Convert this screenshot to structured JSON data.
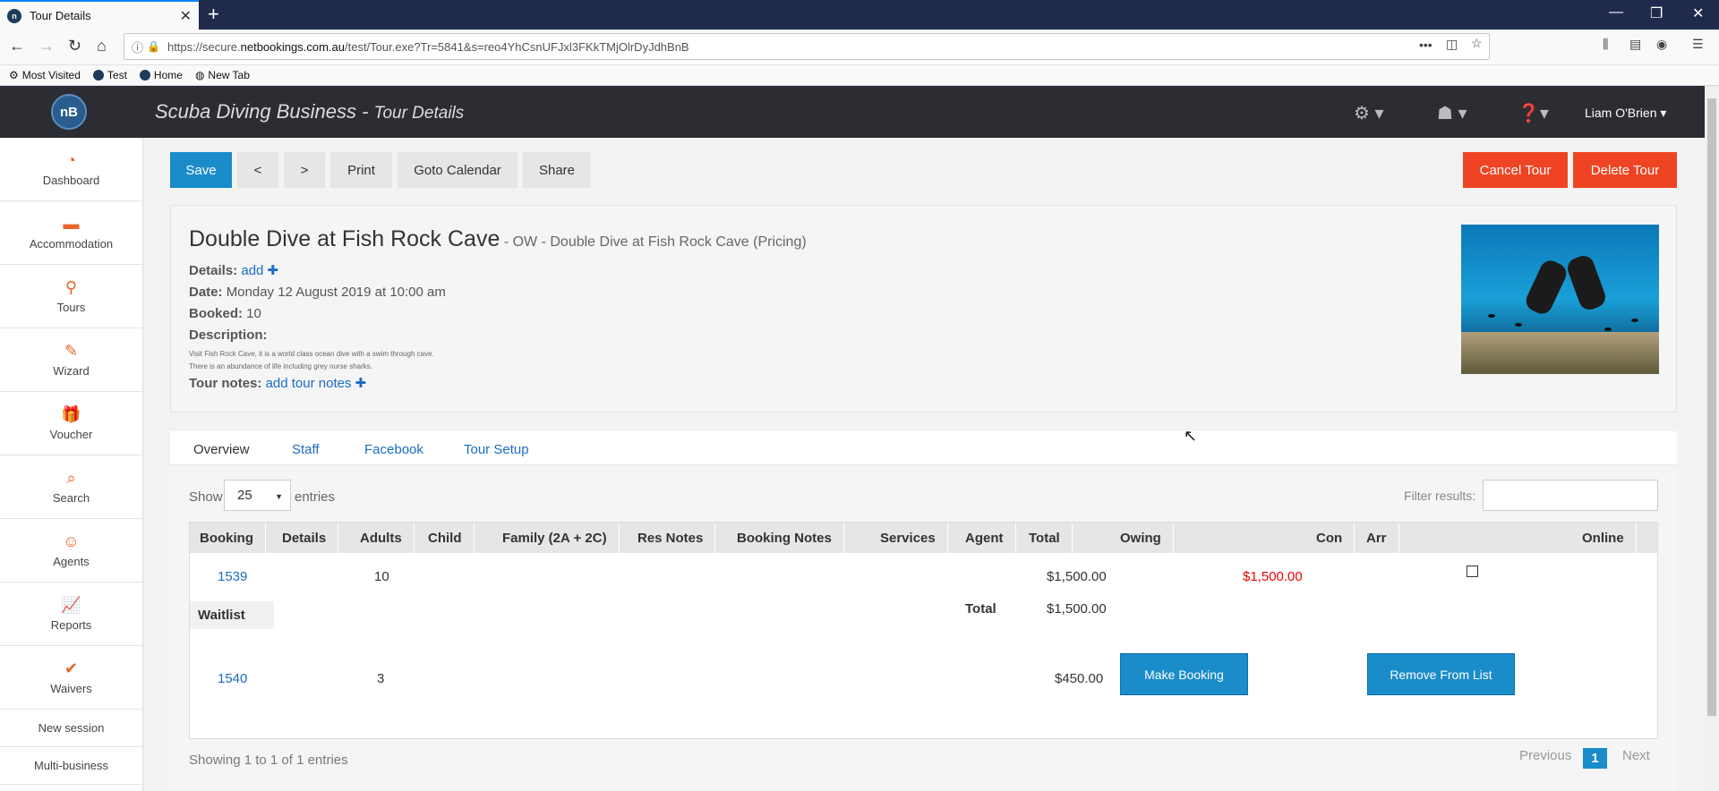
{
  "browser": {
    "tab_title": "Tour Details",
    "url_prefix": "https://secure.",
    "url_domain": "netbookings.com.au",
    "url_path": "/test/Tour.exe?Tr=5841&s=reo4YhCsnUFJxl3FKkTMjOlrDyJdhBnB",
    "bookmarks": [
      "Most Visited",
      "Test",
      "Home",
      "New Tab"
    ]
  },
  "app": {
    "logo_text": "nB",
    "business": "Scuba Diving Business",
    "separator": " - ",
    "page": "Tour Details",
    "user": "Liam O'Brien"
  },
  "sidebar": {
    "items": [
      {
        "label": "Dashboard",
        "icon": "◔"
      },
      {
        "label": "Accommodation",
        "icon": "▬"
      },
      {
        "label": "Tours",
        "icon": "⚲"
      },
      {
        "label": "Wizard",
        "icon": "✎"
      },
      {
        "label": "Voucher",
        "icon": "🎁"
      },
      {
        "label": "Search",
        "icon": "⌕"
      },
      {
        "label": "Agents",
        "icon": "☺"
      },
      {
        "label": "Reports",
        "icon": "📈"
      },
      {
        "label": "Waivers",
        "icon": "✔"
      }
    ],
    "plain": [
      "New session",
      "Multi-business"
    ]
  },
  "toolbar": {
    "save": "Save",
    "prev": "<",
    "next": ">",
    "print": "Print",
    "goto_calendar": "Goto Calendar",
    "share": "Share",
    "cancel_tour": "Cancel Tour",
    "delete_tour": "Delete Tour"
  },
  "tour": {
    "title": "Double Dive at Fish Rock Cave",
    "subtitle": " - OW - Double Dive at Fish Rock Cave (Pricing)",
    "details_label": "Details:",
    "details_link": "add ✚",
    "date_label": "Date:",
    "date_value": "Monday 12 August 2019 at 10:00 am",
    "booked_label": "Booked:",
    "booked_value": "10",
    "description_label": "Description:",
    "description_line1": "Visit Fish Rock Cave, it is a world class ocean dive with a swim through cave.",
    "description_line2": "There is an abundance of life including grey nurse sharks.",
    "notes_label": "Tour notes:",
    "notes_link": "add tour notes ✚"
  },
  "tabs": [
    "Overview",
    "Staff",
    "Facebook",
    "Tour Setup"
  ],
  "table_controls": {
    "show": "Show",
    "page_size": "25",
    "entries": "entries",
    "filter_label": "Filter results:"
  },
  "table": {
    "columns": [
      "Booking",
      "Details",
      "Adults",
      "Child",
      "Family (2A + 2C)",
      "Res Notes",
      "Booking Notes",
      "Services",
      "Agent",
      "Total",
      "Owing",
      "Con",
      "Arr",
      "Online"
    ],
    "rows": [
      {
        "booking": "1539",
        "adults": "10",
        "total": "$1,500.00",
        "owing": "$1,500.00"
      }
    ],
    "total_label": "Total",
    "total_value": "$1,500.00",
    "waitlist_label": "Waitlist",
    "waitlist": [
      {
        "booking": "1540",
        "adults": "3",
        "total": "$450.00",
        "make_booking": "Make Booking",
        "remove": "Remove From List"
      }
    ]
  },
  "footer": {
    "showing": "Showing 1 to 1 of 1 entries",
    "previous": "Previous",
    "current_page": "1",
    "next": "Next"
  }
}
